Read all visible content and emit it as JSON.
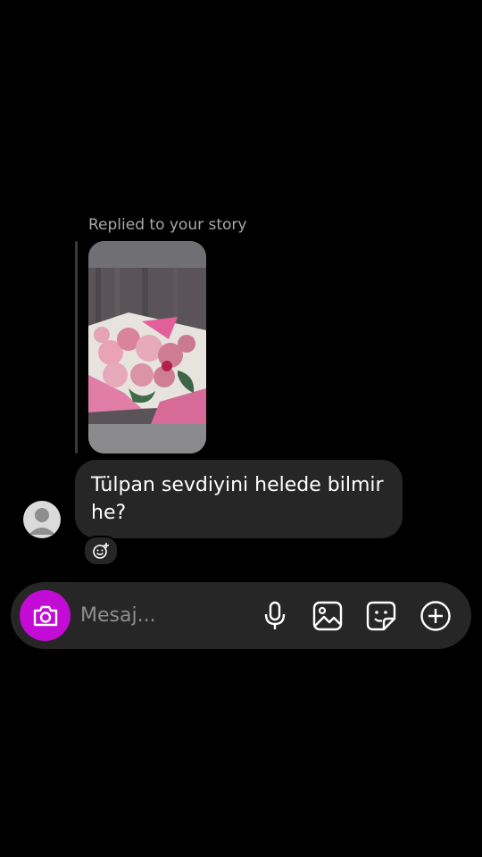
{
  "thread": {
    "replied_label": "Replied to your story",
    "story_thumbnail_icon": "rose-bouquet-photo"
  },
  "message": {
    "text": "Tülpan sevdiyini helede bilmir he?",
    "avatar_icon": "default-avatar-icon"
  },
  "composer": {
    "placeholder": "Mesaj...",
    "camera_color": "#c20bd4",
    "icons": [
      "camera-icon",
      "microphone-icon",
      "gallery-icon",
      "sticker-icon",
      "plus-circle-icon"
    ]
  },
  "colors": {
    "background": "#000000",
    "bubble": "#262626",
    "label": "#a8a8a8"
  }
}
